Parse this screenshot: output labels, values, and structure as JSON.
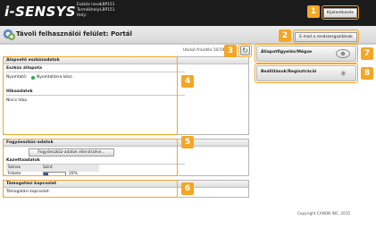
{
  "header": {
    "logo": "i-SENSYS",
    "device": [
      {
        "label": "Eszköz neve:",
        "value": "LBP151"
      },
      {
        "label": "Termékhely:",
        "value": "LBP151"
      },
      {
        "label": "Hely:",
        "value": ""
      }
    ],
    "logout_label": "Kijelentkezés"
  },
  "titlebar": {
    "title": "Távoli felhasználói felület: Portál",
    "mail_button": "E-mail a rendszergazdának"
  },
  "update": {
    "text": "Utolsó frissítés:10/19 201"
  },
  "basic": {
    "heading": "Alapvető eszközadatok",
    "status_heading": "Eszköz állapota",
    "printer_label": "Nyomtató:",
    "printer_status": "Nyomtatásra kész.",
    "errors_heading": "Hibaadatok",
    "errors_text": "Nincs hiba."
  },
  "consumables": {
    "heading": "Fogyóeszköz-adatok",
    "check_button": "Fogyóeszköz-adatok ellenőrzése...",
    "cartridge_heading": "Kazettaadatok",
    "col_color": "Színes",
    "col_level": "Szint",
    "row_color": "Fekete",
    "row_level_text": "20%",
    "row_level": 0.2
  },
  "support": {
    "heading": "Támogatási kapcsolat",
    "text": "Támogatási kapcsolat:"
  },
  "side": {
    "status_monitor": "Állapotfigyelés/Mégse",
    "settings": "Beállítások/Regisztráció"
  },
  "footer": {
    "copyright": "Copyright CANON INC. 2015"
  },
  "annotations": [
    "1",
    "2",
    "3",
    "4",
    "5",
    "6",
    "7",
    "8"
  ],
  "colors": {
    "annotation": "#f5a623",
    "header_bg": "#1b1b1b",
    "status_ready": "#2fa84f"
  }
}
